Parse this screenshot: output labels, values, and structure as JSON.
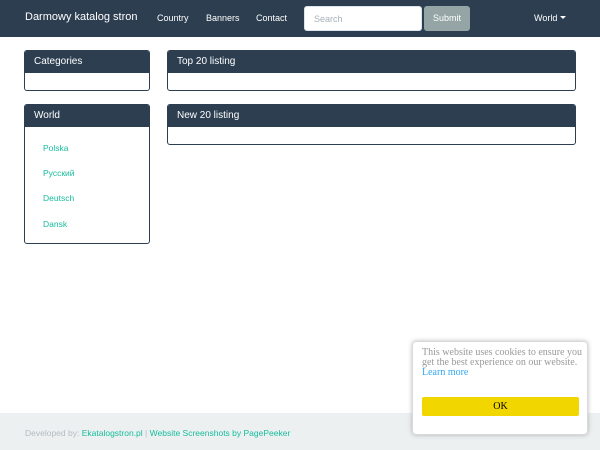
{
  "navbar": {
    "brand": "Darmowy katalog stron",
    "links": [
      "Country",
      "Banners",
      "Contact"
    ],
    "search_placeholder": "Search",
    "submit_label": "Submit",
    "world_label": "World"
  },
  "sidebar": {
    "categories_title": "Categories",
    "world_title": "World",
    "world_items": [
      "Polska",
      "Русский",
      "Deutsch",
      "Dansk"
    ]
  },
  "main": {
    "top_title": "Top 20 listing",
    "new_title": "New 20 listing"
  },
  "footer": {
    "developed_by": "Developed by:",
    "developer_link": "Ekatalogstron.pl",
    "separator": "|",
    "screenshots_link": "Website Screenshots by PagePeeker"
  },
  "cookie": {
    "message": "This website uses cookies to ensure you get the best experience on our website.",
    "learn_more": "Learn more",
    "ok_label": "OK"
  },
  "colors": {
    "primary": "#2c3e50",
    "link": "#18bc9c",
    "submit": "#95a5a6",
    "footer_bg": "#ecf0f1",
    "cookie_button": "#f1d600",
    "cookie_link": "#31a8f0"
  }
}
